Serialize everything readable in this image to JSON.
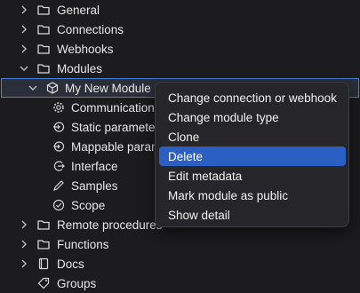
{
  "tree": {
    "general": "General",
    "connections": "Connections",
    "webhooks": "Webhooks",
    "modules": "Modules",
    "module_name": "My New Module",
    "communication": "Communication",
    "static_parameters": "Static parameters",
    "mappable_parameters": "Mappable parameters",
    "interface": "Interface",
    "samples": "Samples",
    "scope": "Scope",
    "remote_procedures": "Remote procedures",
    "functions": "Functions",
    "docs": "Docs",
    "groups": "Groups"
  },
  "context_menu": {
    "items": [
      "Change connection or webhook",
      "Change module type",
      "Clone",
      "Delete",
      "Edit metadata",
      "Mark module as public",
      "Show detail"
    ],
    "active_item": "Delete"
  },
  "colors": {
    "background": "#1c1c1e",
    "menu_background": "#26262a",
    "highlight": "#2c5fc2",
    "selected_border": "#4a7fd6"
  },
  "icons": [
    "chevron-right-icon",
    "chevron-down-icon",
    "folder-icon",
    "cube-icon",
    "gear-icon",
    "param-icon",
    "interface-icon",
    "pen-icon",
    "check-circle-icon",
    "book-icon",
    "tag-icon"
  ]
}
